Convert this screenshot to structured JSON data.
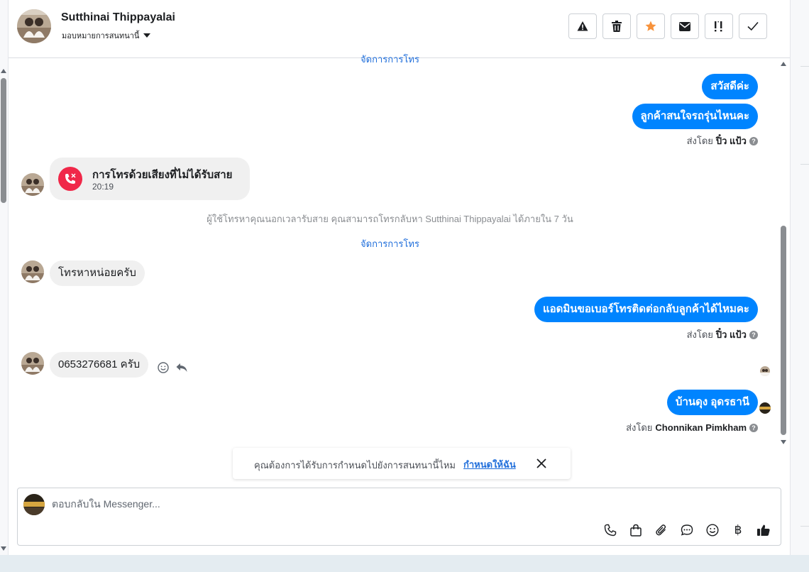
{
  "header": {
    "name": "Sutthinai Thippayalai",
    "assign_label": "มอบหมายการสนทนานี้"
  },
  "toolbar": {
    "buttons": [
      {
        "name": "spam-button",
        "icon": "warning-icon"
      },
      {
        "name": "delete-button",
        "icon": "trash-icon"
      },
      {
        "name": "star-button",
        "icon": "star-icon"
      },
      {
        "name": "mark-unread-button",
        "icon": "envelope-icon"
      },
      {
        "name": "follow-up-button",
        "icon": "flag-exclamation-icon"
      },
      {
        "name": "mark-done-button",
        "icon": "check-icon"
      }
    ],
    "star_color": "#f7923b"
  },
  "conversation": {
    "top_cut_text": "จัดการการโทร",
    "messages": {
      "out1": "สวัสดีค่ะ",
      "out2": "ลูกค้าสนใจรถรุ่นไหนคะ",
      "sent_by_1_prefix": "ส่งโดย",
      "sent_by_1_name": "ปิ๋ว แป้ว",
      "missed_call_title": "การโทรด้วยเสียงที่ไม่ได้รับสาย",
      "missed_call_time": "20:19",
      "system_note": "ผู้ใช้โทรหาคุณนอกเวลารับสาย คุณสามารถโทรกลับหา Sutthinai Thippayalai ได้ภายใน 7 วัน",
      "manage_calls_link": "จัดการการโทร",
      "in1": "โทรหาหน่อยครับ",
      "out3": "แอดมินขอเบอร์โทรติดต่อกลับลูกค้าได้ไหมคะ",
      "sent_by_2_prefix": "ส่งโดย",
      "sent_by_2_name": "ปิ๋ว แป้ว",
      "in2": "0653276681 ครับ",
      "out4": "บ้านดุง อุดรธานี",
      "sent_by_3_prefix": "ส่งโดย",
      "sent_by_3_name": "Chonnikan Pimkham"
    }
  },
  "banner": {
    "text": "คุณต้องการได้รับการกำหนดไปยังการสนทนานี้ไหม",
    "link": "กำหนดให้ฉัน"
  },
  "composer": {
    "placeholder": "ตอบกลับใน Messenger...",
    "icons": [
      "phone-icon",
      "shopping-bag-icon",
      "paperclip-icon",
      "saved-reply-icon",
      "emoji-icon",
      "baht-icon",
      "thumbs-up-icon"
    ],
    "baht_symbol": "฿"
  },
  "colors": {
    "outgoing_bubble": "#0084ff",
    "incoming_bubble": "#f0f0f0",
    "missed_call": "#f02849",
    "link": "#216fdb"
  }
}
